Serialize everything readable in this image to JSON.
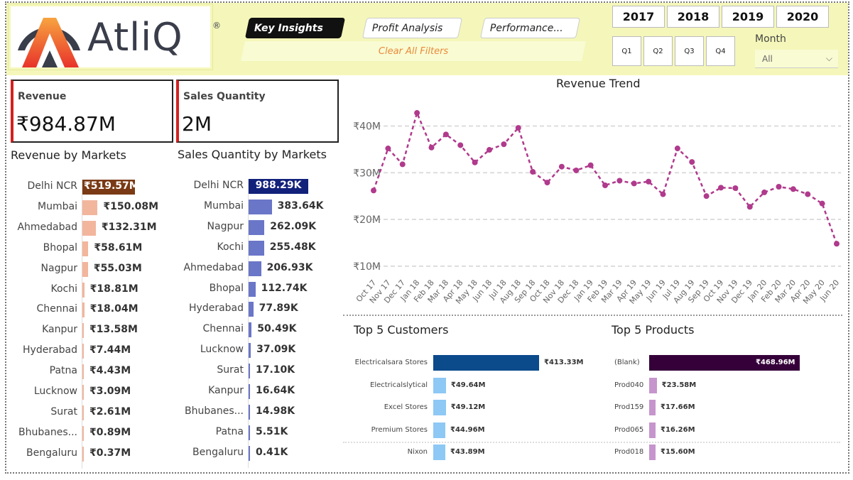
{
  "brand": {
    "name": "AtliQ",
    "reg": "®"
  },
  "nav": {
    "key_insights": "Key Insights",
    "profit_analysis": "Profit Analysis",
    "performance": "Performance...",
    "clear_filters": "Clear All Filters"
  },
  "filters": {
    "years": [
      "2017",
      "2018",
      "2019",
      "2020"
    ],
    "quarters": [
      "Q1",
      "Q2",
      "Q3",
      "Q4"
    ],
    "month_label": "Month",
    "month_value": "All"
  },
  "kpis": {
    "revenue": {
      "label": "Revenue",
      "value": "₹984.87M"
    },
    "sales_qty": {
      "label": "Sales Quantity",
      "value": "2M"
    }
  },
  "revenue_by_markets": {
    "title": "Revenue by Markets",
    "rows": [
      {
        "market": "Delhi NCR",
        "value": 519.57,
        "label": "₹519.57M"
      },
      {
        "market": "Mumbai",
        "value": 150.08,
        "label": "₹150.08M"
      },
      {
        "market": "Ahmedabad",
        "value": 132.31,
        "label": "₹132.31M"
      },
      {
        "market": "Bhopal",
        "value": 58.61,
        "label": "₹58.61M"
      },
      {
        "market": "Nagpur",
        "value": 55.03,
        "label": "₹55.03M"
      },
      {
        "market": "Kochi",
        "value": 18.81,
        "label": "₹18.81M"
      },
      {
        "market": "Chennai",
        "value": 18.04,
        "label": "₹18.04M"
      },
      {
        "market": "Kanpur",
        "value": 13.58,
        "label": "₹13.58M"
      },
      {
        "market": "Hyderabad",
        "value": 7.44,
        "label": "₹7.44M"
      },
      {
        "market": "Patna",
        "value": 4.43,
        "label": "₹4.43M"
      },
      {
        "market": "Lucknow",
        "value": 3.09,
        "label": "₹3.09M"
      },
      {
        "market": "Surat",
        "value": 2.61,
        "label": "₹2.61M"
      },
      {
        "market": "Bhubanes...",
        "value": 0.89,
        "label": "₹0.89M"
      },
      {
        "market": "Bengaluru",
        "value": 0.37,
        "label": "₹0.37M"
      }
    ]
  },
  "qty_by_markets": {
    "title": "Sales Quantity by Markets",
    "rows": [
      {
        "market": "Delhi NCR",
        "value": 988.29,
        "label": "988.29K"
      },
      {
        "market": "Mumbai",
        "value": 383.64,
        "label": "383.64K"
      },
      {
        "market": "Nagpur",
        "value": 262.09,
        "label": "262.09K"
      },
      {
        "market": "Kochi",
        "value": 255.48,
        "label": "255.48K"
      },
      {
        "market": "Ahmedabad",
        "value": 206.93,
        "label": "206.93K"
      },
      {
        "market": "Bhopal",
        "value": 112.74,
        "label": "112.74K"
      },
      {
        "market": "Hyderabad",
        "value": 77.89,
        "label": "77.89K"
      },
      {
        "market": "Chennai",
        "value": 50.49,
        "label": "50.49K"
      },
      {
        "market": "Lucknow",
        "value": 37.09,
        "label": "37.09K"
      },
      {
        "market": "Surat",
        "value": 17.1,
        "label": "17.10K"
      },
      {
        "market": "Kanpur",
        "value": 16.64,
        "label": "16.64K"
      },
      {
        "market": "Bhubanes...",
        "value": 14.98,
        "label": "14.98K"
      },
      {
        "market": "Patna",
        "value": 5.51,
        "label": "5.51K"
      },
      {
        "market": "Bengaluru",
        "value": 0.41,
        "label": "0.41K"
      }
    ]
  },
  "chart_data": [
    {
      "type": "line",
      "title": "Revenue Trend",
      "x": [
        "Oct 17",
        "Nov 17",
        "Dec 17",
        "Jan 18",
        "Feb 18",
        "Mar 18",
        "Apr 18",
        "May 18",
        "Jun 18",
        "Jul 18",
        "Aug 18",
        "Sep 18",
        "Oct 18",
        "Nov 18",
        "Dec 18",
        "Jan 19",
        "Feb 19",
        "Mar 19",
        "Apr 19",
        "May 19",
        "Jun 19",
        "Jul 19",
        "Aug 19",
        "Sep 19",
        "Oct 19",
        "Nov 19",
        "Dec 19",
        "Jan 20",
        "Feb 20",
        "Mar 20",
        "Apr 20",
        "May 20",
        "Jun 20"
      ],
      "y": [
        26.2,
        35.2,
        31.8,
        42.8,
        35.4,
        38.2,
        35.9,
        32.2,
        34.9,
        36.1,
        39.6,
        30.2,
        27.9,
        31.3,
        30.5,
        31.6,
        27.3,
        28.3,
        27.7,
        28.1,
        25.4,
        35.2,
        32.3,
        25.0,
        26.8,
        26.7,
        22.7,
        25.8,
        27.0,
        26.5,
        25.4,
        23.4,
        14.8
      ],
      "y_ticks": [
        "₹10M",
        "₹20M",
        "₹30M",
        "₹40M"
      ],
      "y_tick_values": [
        10,
        20,
        30,
        40
      ],
      "ylim": [
        8,
        46
      ],
      "grid": true,
      "color": "#b03a8c"
    },
    {
      "type": "bar",
      "title": "Top 5 Customers",
      "categories": [
        "Electricalsara Stores",
        "Electricalslytical",
        "Excel Stores",
        "Premium Stores",
        "Nixon"
      ],
      "values": [
        413.33,
        49.64,
        49.12,
        44.96,
        43.89
      ],
      "labels": [
        "₹413.33M",
        "₹49.64M",
        "₹49.12M",
        "₹44.96M",
        "₹43.89M"
      ],
      "colors": [
        "#0b4a8b",
        "#8ec8f5"
      ]
    },
    {
      "type": "bar",
      "title": "Top 5 Products",
      "categories": [
        "(Blank)",
        "Prod040",
        "Prod159",
        "Prod065",
        "Prod018"
      ],
      "values": [
        468.96,
        23.58,
        17.66,
        16.26,
        15.6
      ],
      "labels": [
        "₹468.96M",
        "₹23.58M",
        "₹17.66M",
        "₹16.26M",
        "₹15.60M"
      ],
      "colors": [
        "#35003a",
        "#c695cc"
      ]
    }
  ],
  "colors": {
    "accent_red": "#d42020",
    "revenue_top_bar": "#7a3a15",
    "revenue_bar": "#f2b69d",
    "qty_top_bar": "#12217a",
    "qty_bar": "#6a76c8",
    "header_bg": "#f4f7b9"
  }
}
